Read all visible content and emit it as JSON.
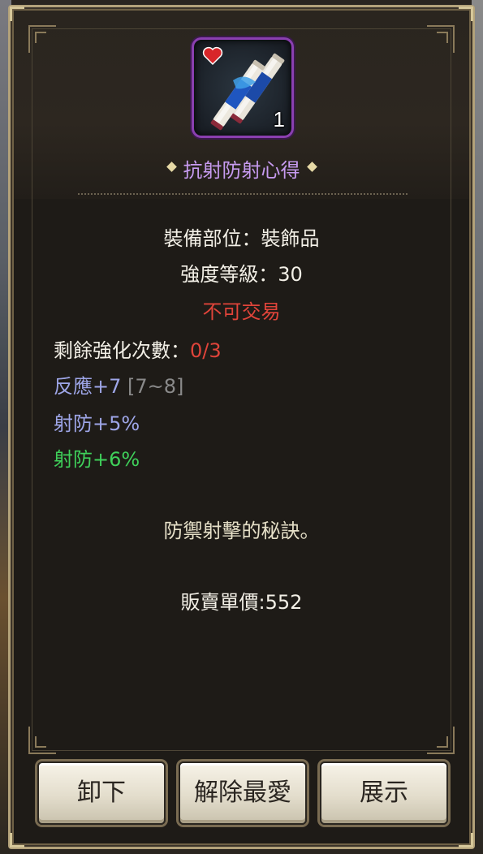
{
  "item": {
    "name": "抗射防射心得",
    "stack_count": "1",
    "rarity_color": "#8a3fb0",
    "name_color": "#c79bf0",
    "icon": "scroll-icon",
    "favorite_icon": "heart-icon"
  },
  "stats": {
    "slot_line": "裝備部位：裝飾品",
    "strength_line": "強度等級：30",
    "trade_line": "不可交易",
    "enhance_label": "剩餘強化次數：",
    "enhance_value": "0/3",
    "reaction": "反應+7",
    "reaction_range": "[7~8]",
    "ranged_def_1": "射防+5%",
    "ranged_def_2": "射防+6%"
  },
  "description": "防禦射擊的秘訣。",
  "price_line": "販賣單價:552",
  "buttons": {
    "unequip": "卸下",
    "unfavorite": "解除最愛",
    "show": "展示"
  }
}
